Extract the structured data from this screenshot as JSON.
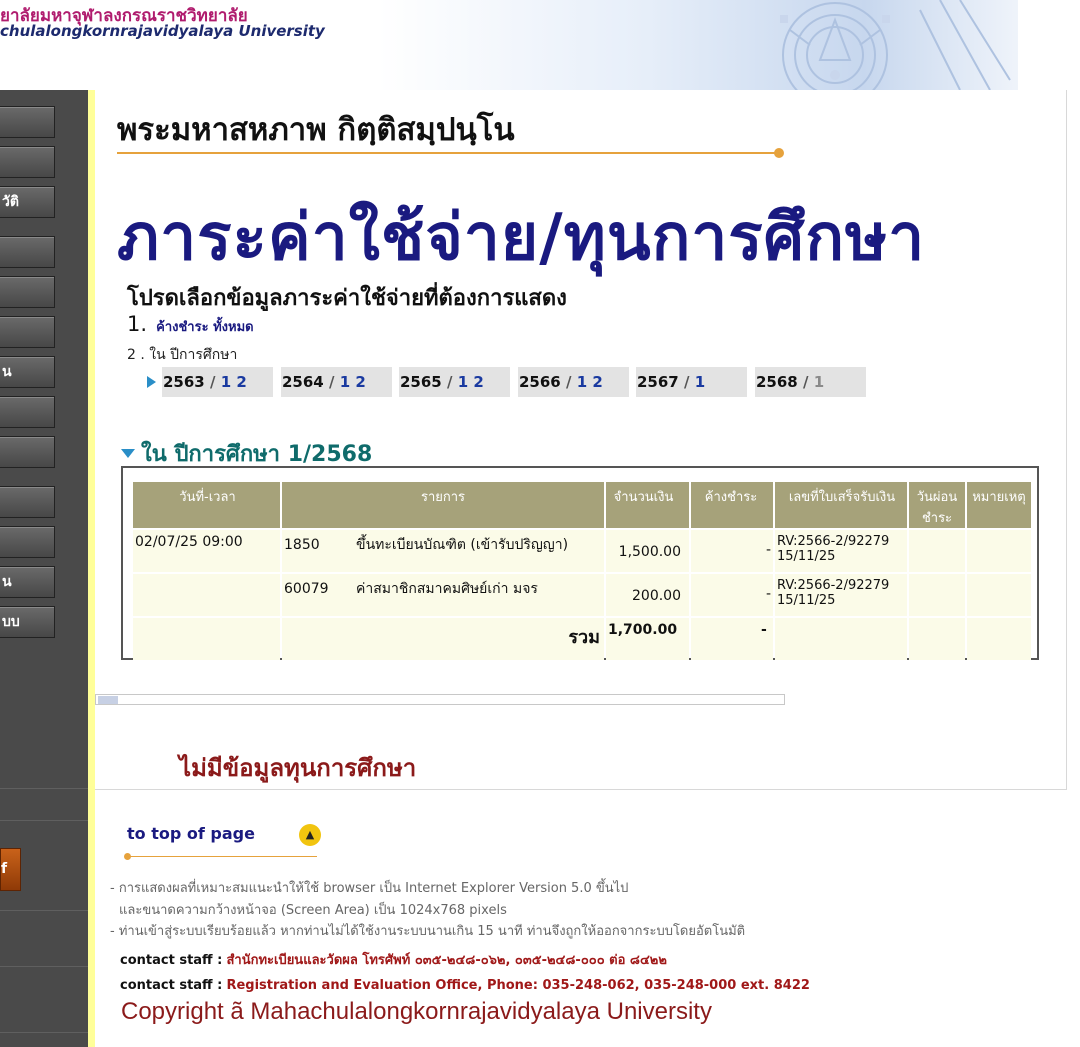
{
  "header": {
    "uni_thai": "ยาลัยมหาจุฬาลงกรณราชวิทยาลัย",
    "uni_english": "chulalongkornrajavidyalaya University"
  },
  "sidebar": {
    "items": [
      {
        "label": ""
      },
      {
        "label": ""
      },
      {
        "label": "วัติ"
      },
      {
        "label": ""
      },
      {
        "label": ""
      },
      {
        "label": ""
      },
      {
        "label": "น"
      },
      {
        "label": ""
      },
      {
        "label": ""
      },
      {
        "label": ""
      },
      {
        "label": ""
      },
      {
        "label": "น"
      },
      {
        "label": "บบ"
      }
    ],
    "orange_button_label": "f"
  },
  "main": {
    "student_name": "พระมหาสหภาพ กิตฺติสมฺปนฺโน",
    "page_heading": "ภาระค่าใช้จ่าย/ทุนการศึกษา",
    "select_label": "โปรดเลือกข้อมูลภาระค่าใช้จ่ายที่ต้องการแสดง",
    "option1_number": "1.",
    "option1_link": "ค้างชำระ ทั้งหมด",
    "option2_text": "2 . ใน ปีการศึกษา",
    "years": [
      {
        "year": "2563",
        "sep": "/",
        "sems": "1 2"
      },
      {
        "year": "2564",
        "sep": "/",
        "sems": "1 2"
      },
      {
        "year": "2565",
        "sep": "/",
        "sems": "1 2"
      },
      {
        "year": "2566",
        "sep": "/",
        "sems": "1 2"
      },
      {
        "year": "2567",
        "sep": "/",
        "sems": "1"
      },
      {
        "year": "2568",
        "sep": "/",
        "sems": "1"
      }
    ],
    "semester_heading": "ใน ปีการศึกษา 1/2568",
    "table": {
      "headers": [
        "วันที่-เวลา",
        "รายการ",
        "จำนวนเงิน",
        "ค้างชำระ",
        "เลขที่ใบเสร็จรับเงิน",
        "วันผ่อนชำระ",
        "หมายเหตุ"
      ],
      "rows": [
        {
          "datetime": "02/07/25 09:00",
          "code": "1850",
          "desc": "ขึ้นทะเบียนบัณฑิต (เข้ารับปริญญา)",
          "amount": "1,500.00",
          "due": "-",
          "receipt": "RV:2566-2/92279",
          "receipt_date": "15/11/25",
          "installment": "",
          "note": ""
        },
        {
          "datetime": "",
          "code": "60079",
          "desc": "ค่าสมาชิกสมาคมศิษย์เก่า มจร",
          "amount": "200.00",
          "due": "-",
          "receipt": "RV:2566-2/92279",
          "receipt_date": "15/11/25",
          "installment": "",
          "note": ""
        }
      ],
      "total_label": "รวม",
      "total_amount": "1,700.00",
      "total_due": "-"
    },
    "no_scholarship": "ไม่มีข้อมูลทุนการศึกษา"
  },
  "footer": {
    "to_top": "to top of page",
    "to_top_icon": "▲",
    "note1": "- การแสดงผลที่เหมาะสมแนะนำให้ใช้ browser เป็น Internet Explorer Version 5.0 ขึ้นไป",
    "note2": "และขนาดความกว้างหน้าจอ (Screen Area) เป็น 1024x768 pixels",
    "note3": "- ท่านเข้าสู่ระบบเรียบร้อยแล้ว หากท่านไม่ได้ใช้งานระบบนานเกิน 15 นาที ท่านจึงถูกให้ออกจากระบบโดยอัตโนมัติ",
    "contact_label": "contact staff :",
    "contact_thai": "สำนักทะเบียนและวัดผล โทรศัพท์ ๐๓๕-๒๔๘-๐๖๒, ๐๓๕-๒๔๘-๐๐๐ ต่อ ๘๔๒๒",
    "contact_english": "Registration and Evaluation Office, Phone: 035-248-062, 035-248-000 ext. 8422",
    "copyright": "Copyright ã Mahachulalongkornrajavidyalaya University"
  },
  "colors": {
    "heading_navy": "#1a1a80",
    "teal": "#0f6b6b",
    "table_header": "#a6a27a",
    "maroon": "#8b1a1a",
    "accent_blue": "#2a8ec7",
    "sidebar": "#4a4a4a"
  }
}
